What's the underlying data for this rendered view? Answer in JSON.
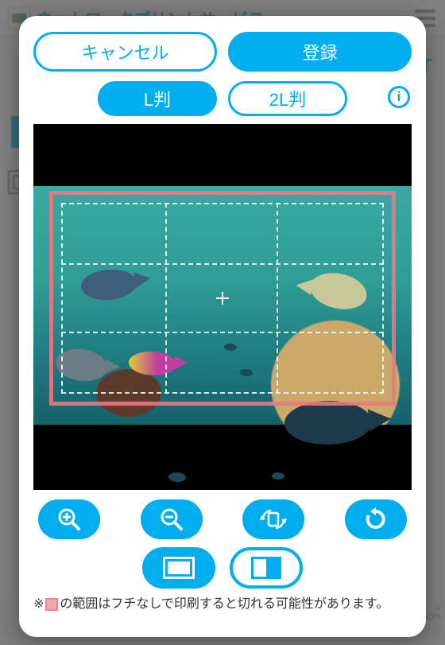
{
  "background": {
    "title": "ネットワークプリントサービス",
    "right_badge": "T",
    "footer_line1": ".9",
    "footer_line2": "(C) SHARP MARKETING JAPAN CORPORATION"
  },
  "modal": {
    "cancel_label": "キャンセル",
    "register_label": "登録",
    "size_l_label": "L判",
    "size_2l_label": "2L判",
    "info_label": "i",
    "size_selected": "L判",
    "tools": {
      "zoom_in": "zoom-in",
      "zoom_out": "zoom-out",
      "rotate_device": "rotate-device",
      "reset": "reset"
    },
    "orientation_selected": "landscape",
    "footnote_prefix": "※",
    "footnote_text": "の範囲はフチなしで印刷すると切れる可能性があります。"
  }
}
